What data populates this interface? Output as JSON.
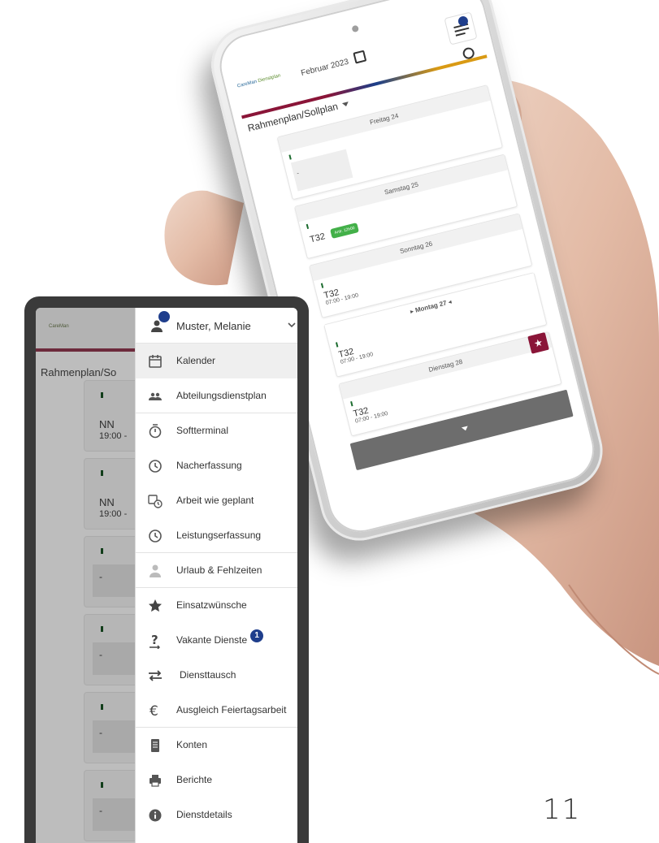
{
  "phone": {
    "logo": "CareMan",
    "logo_sub": "Dienstplan",
    "month": "Februar 2023",
    "view_label": "Rahmenplan/Sollplan",
    "days": [
      {
        "title": "Freitag 24",
        "code": "",
        "time": "",
        "placeholder": "-"
      },
      {
        "title": "Samstag 25",
        "code": "T32",
        "time": "",
        "chip": "Antr. 12h00"
      },
      {
        "title": "Sonntag 26",
        "code": "T32",
        "time": "07:00 - 19:00"
      },
      {
        "title": "Montag 27",
        "code": "T32",
        "time": "07:00 - 19:00"
      },
      {
        "title": "Dienstag 28",
        "code": "T32",
        "time": "07:00 - 19:00"
      }
    ]
  },
  "background_app": {
    "logo": "CareMan",
    "title": "Rahmenplan/So",
    "cards": [
      {
        "code": "NN",
        "time": "19:00 -"
      },
      {
        "code": "NN",
        "time": "19:00 -"
      },
      {
        "dash": "-"
      },
      {
        "dash": "-"
      },
      {
        "dash": "-"
      },
      {
        "dash": "-"
      }
    ]
  },
  "menu": {
    "user_name": "Muster, Melanie",
    "items": [
      {
        "label": "Kalender",
        "icon": "calendar-icon"
      },
      {
        "label": "Abteilungsdienstplan",
        "icon": "group-icon"
      },
      {
        "label": "Softterminal",
        "icon": "stopwatch-icon"
      },
      {
        "label": "Nacherfassung",
        "icon": "clock-icon"
      },
      {
        "label": "Arbeit wie geplant",
        "icon": "calendar-clock-icon"
      },
      {
        "label": "Leistungserfassung",
        "icon": "clock-icon"
      },
      {
        "label": "Urlaub & Fehlzeiten",
        "icon": "person-icon"
      },
      {
        "label": "Einsatzwünsche",
        "icon": "star-icon"
      },
      {
        "label": "Vakante Dienste",
        "icon": "question-icon",
        "badge": "1"
      },
      {
        "label": "Diensttausch",
        "icon": "swap-icon"
      },
      {
        "label": "Ausgleich Feiertagsarbeit",
        "icon": "euro-icon"
      },
      {
        "label": "Konten",
        "icon": "book-icon"
      },
      {
        "label": "Berichte",
        "icon": "printer-icon"
      },
      {
        "label": "Dienstdetails",
        "icon": "info-icon"
      }
    ]
  },
  "page_number": "11"
}
